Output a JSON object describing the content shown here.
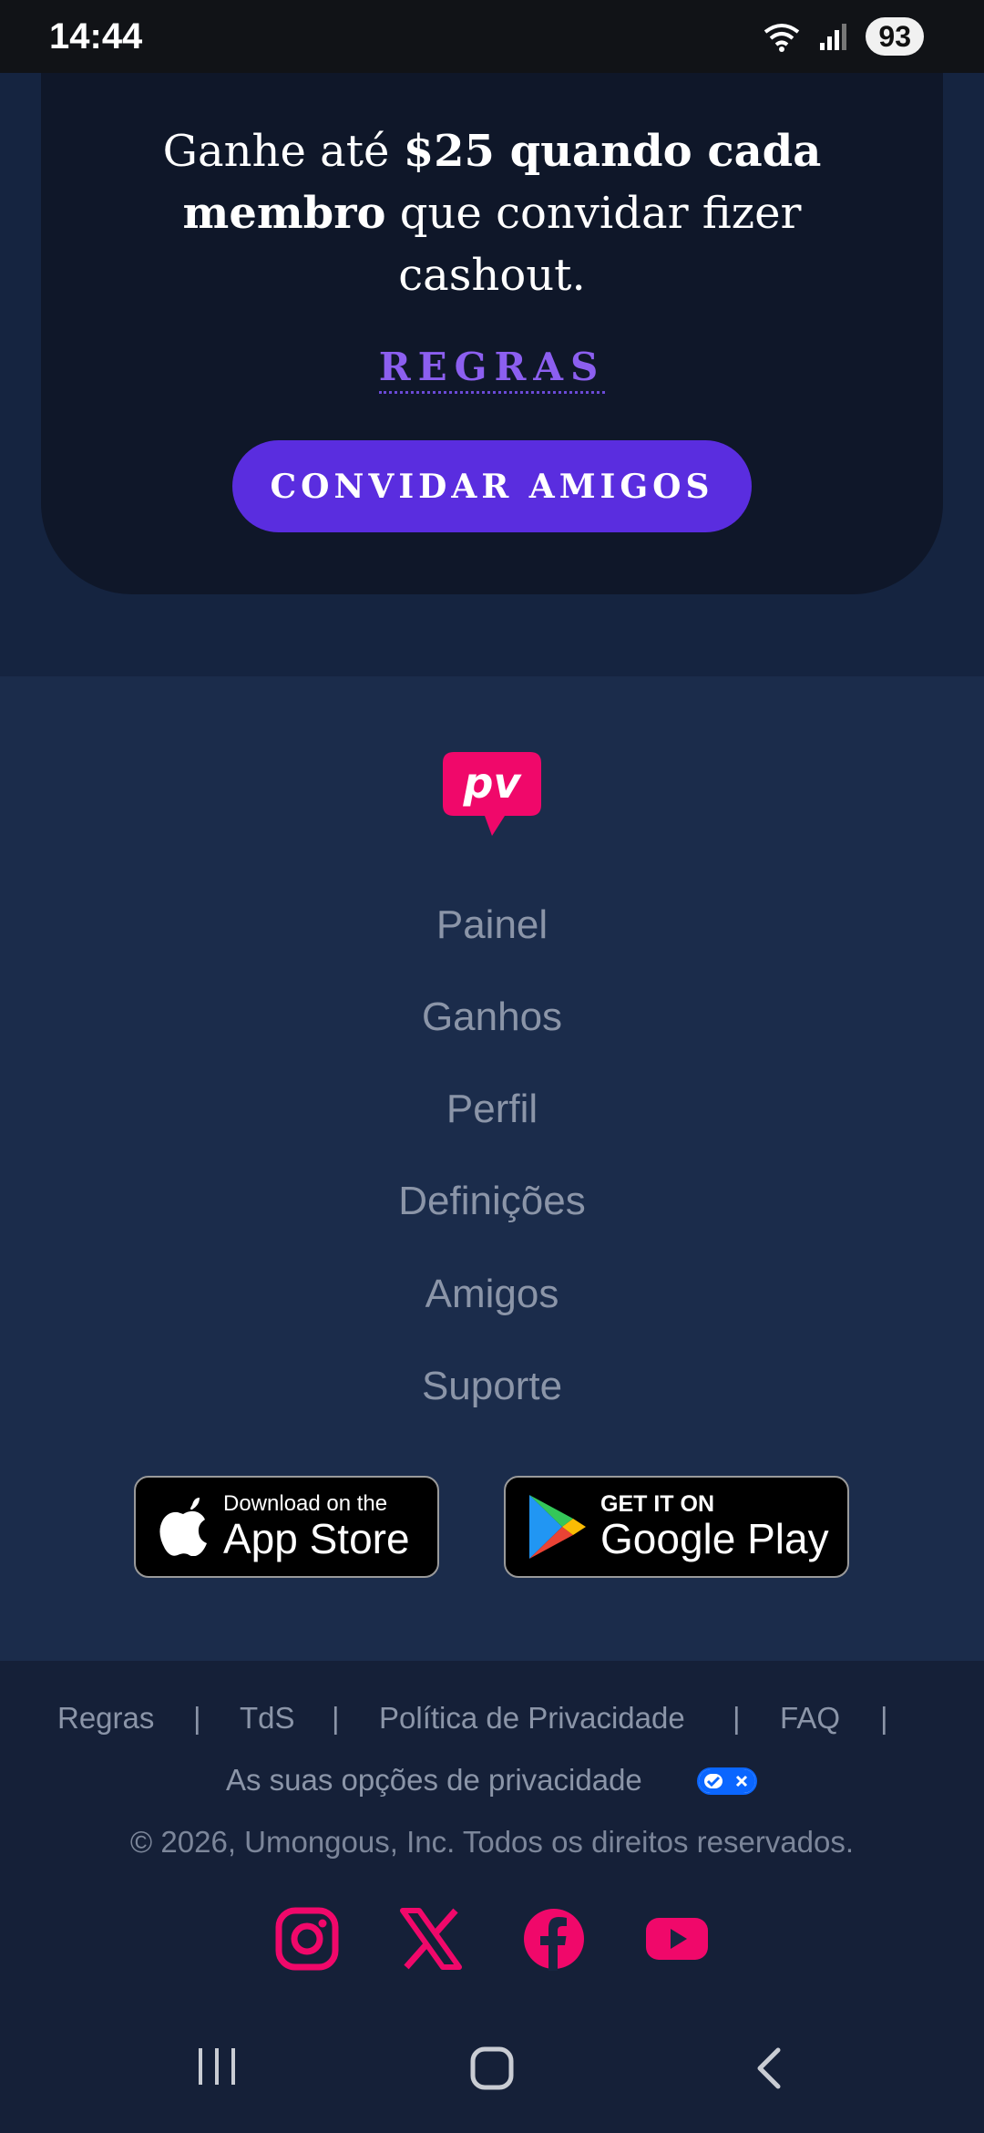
{
  "status_bar": {
    "time": "14:44",
    "battery": "93"
  },
  "invite": {
    "text_1": "Ganhe até ",
    "text_bold_1": "$25 quando cada membro",
    "text_2": " que convidar fizer cashout.",
    "rules_label": "REGRAS",
    "button_label": "CONVIDAR AMIGOS"
  },
  "footer": {
    "logo_text": "pv",
    "nav": [
      "Painel",
      "Ganhos",
      "Perfil",
      "Definições",
      "Amigos",
      "Suporte"
    ],
    "app_store": {
      "small": "Download on the",
      "big": "App Store"
    },
    "google_play": {
      "small": "GET IT ON",
      "big": "Google Play"
    },
    "legal": [
      "Regras",
      "TdS",
      "Política de Privacidade",
      "FAQ"
    ],
    "separator": "|",
    "privacy_choices": "As suas opções de privacidade",
    "copyright": "© 2026, Umongous, Inc. Todos os direitos reservados."
  },
  "colors": {
    "accent": "#5a2ddf",
    "rules_link": "#8c5ff0",
    "brand_pink": "#f0086a",
    "footer_bg": "#1b2c4b"
  },
  "icons": [
    "instagram-icon",
    "x-icon",
    "facebook-icon",
    "youtube-icon",
    "apple-icon",
    "google-play-icon"
  ]
}
